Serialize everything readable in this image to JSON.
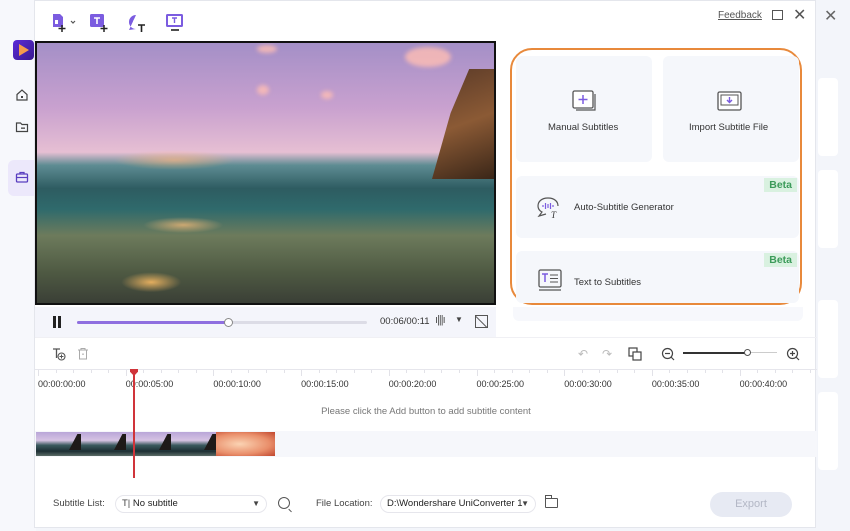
{
  "app": {
    "feedback_link": "Feedback"
  },
  "toolbar": {
    "icons": [
      "add-file-icon",
      "add-subtitle-icon",
      "auto-subtitle-icon",
      "text-subtitle-icon"
    ]
  },
  "player": {
    "current_time": "00:06",
    "duration": "00:11",
    "time_display": "00:06/00:11",
    "progress_fraction": 0.52
  },
  "options": {
    "manual": {
      "label": "Manual Subtitles"
    },
    "import": {
      "label": "Import Subtitle File"
    },
    "auto": {
      "label": "Auto-Subtitle Generator",
      "badge": "Beta"
    },
    "text": {
      "label": "Text to Subtitles",
      "badge": "Beta"
    }
  },
  "timeline": {
    "ruler_labels": [
      "00:00:00:00",
      "00:00:05:00",
      "00:00:10:00",
      "00:00:15:00",
      "00:00:20:00",
      "00:00:25:00",
      "00:00:30:00",
      "00:00:35:00",
      "00:00:40:00"
    ],
    "hint": "Please click the Add button to add subtitle content",
    "zoom_fraction": 0.7,
    "playhead_time": "00:00:05:00"
  },
  "footer": {
    "subtitle_list_label": "Subtitle List:",
    "subtitle_list_value": "No subtitle",
    "file_location_label": "File Location:",
    "file_location_value": "D:\\Wondershare UniConverter 1",
    "export_label": "Export"
  },
  "colors": {
    "accent": "#8f6fe0",
    "highlight_border": "#e8893b",
    "beta_bg": "#d9f1e0",
    "beta_text": "#3c9b5a",
    "playhead": "#d0343a"
  }
}
